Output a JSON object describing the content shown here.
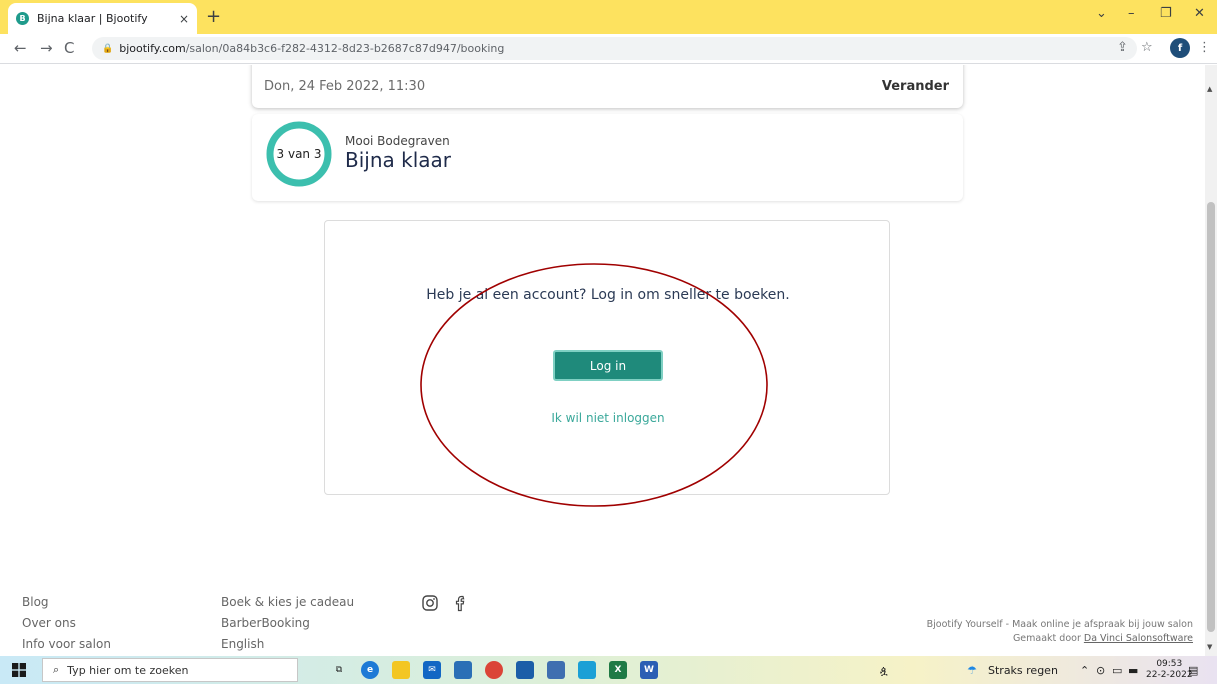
{
  "browser": {
    "tab_title": "Bijna klaar | Bjootify",
    "tab_favicon_letter": "B",
    "tab_close": "×",
    "new_tab": "+",
    "url_host": "bjootify.com",
    "url_path": "/salon/0a84b3c6-f282-4312-8d23-b2687c87d947/booking",
    "profile_letter": "f"
  },
  "booking": {
    "date_text": "Don, 24 Feb 2022, 11:30",
    "change_label": "Verander",
    "salon_name": "Mooi Bodegraven",
    "step_progress": "3 van 3",
    "step_fraction": 1.0,
    "step_title": "Bijna klaar",
    "accent_color": "#1f8a7b"
  },
  "login": {
    "question": "Heb je al een account? Log in om sneller te boeken.",
    "login_button": "Log in",
    "skip_link": "Ik wil niet inloggen"
  },
  "annotation": {
    "color": "#a00000",
    "shape": "ellipse"
  },
  "footer": {
    "col1": [
      "Blog",
      "Over ons",
      "Info voor salon"
    ],
    "col2": [
      "Boek & kies je cadeau",
      "BarberBooking",
      "English"
    ],
    "social_icons": [
      "instagram-icon",
      "facebook-icon"
    ],
    "tagline": "Bjootify Yourself - Maak online je afspraak bij jouw salon",
    "made_by_prefix": "Gemaakt door ",
    "made_by_link": "Da Vinci Salonsoftware"
  },
  "taskbar": {
    "search_placeholder": "Typ hier om te zoeken",
    "weather": "Straks regen",
    "time": "09:53",
    "date": "22-2-2022"
  }
}
